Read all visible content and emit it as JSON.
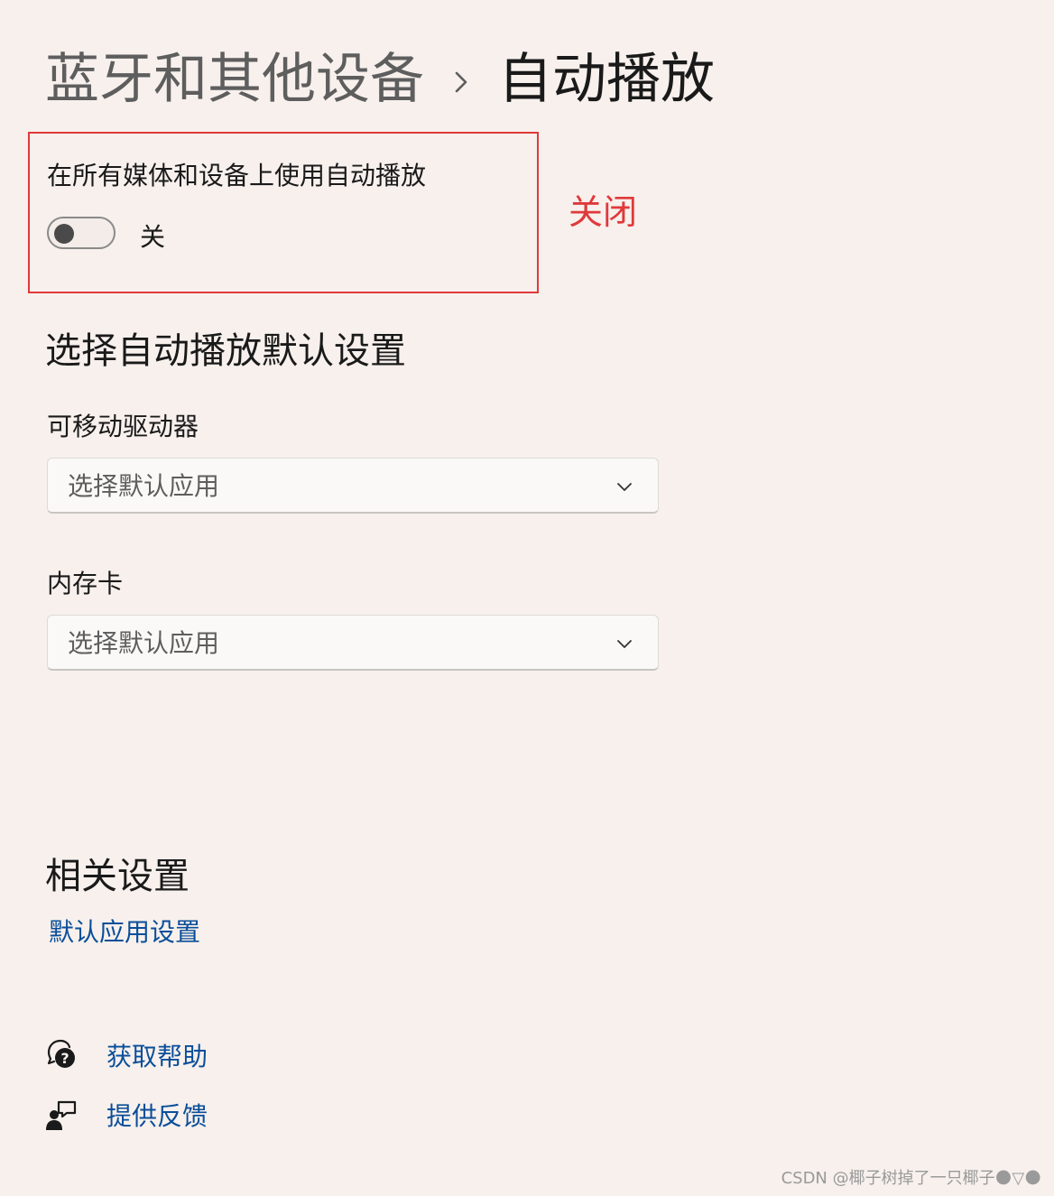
{
  "breadcrumb": {
    "parent": "蓝牙和其他设备",
    "separator_icon": "chevron-right-icon",
    "current": "自动播放"
  },
  "autoplay": {
    "label": "在所有媒体和设备上使用自动播放",
    "toggle_on": false,
    "toggle_state_text": "关",
    "annotation": "关闭",
    "annotation_color": "#e0393b"
  },
  "defaults": {
    "title": "选择自动播放默认设置",
    "removable_drive": {
      "label": "可移动驱动器",
      "value": "选择默认应用"
    },
    "memory_card": {
      "label": "内存卡",
      "value": "选择默认应用"
    }
  },
  "related": {
    "title": "相关设置",
    "default_apps_link": "默认应用设置"
  },
  "footer": {
    "help": {
      "icon": "help-chat-icon",
      "label": "获取帮助"
    },
    "feedback": {
      "icon": "feedback-icon",
      "label": "提供反馈"
    }
  },
  "watermark": "CSDN @椰子树掉了一只椰子🌑▽🌑",
  "colors": {
    "background": "#f7f0ec",
    "link": "#0a4e9a",
    "accent_red": "#e0393b"
  }
}
